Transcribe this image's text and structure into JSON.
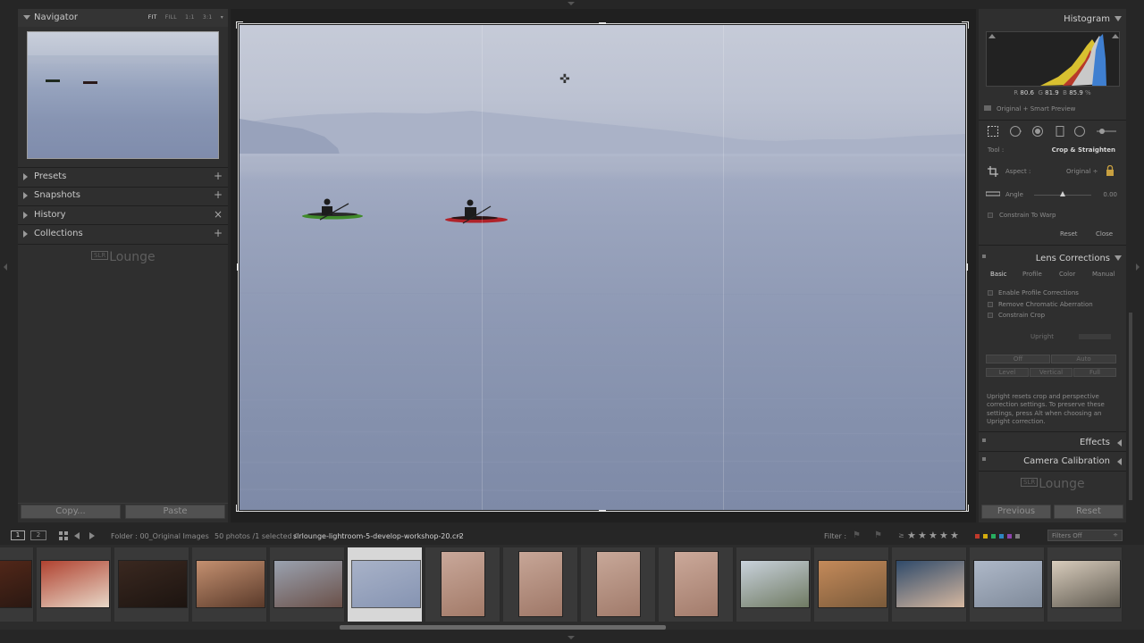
{
  "left_panel": {
    "navigator": {
      "title": "Navigator",
      "zoom_options": [
        "FIT",
        "FILL",
        "1:1",
        "3:1"
      ],
      "zoom_selected": "FIT"
    },
    "sections": [
      {
        "label": "Presets",
        "action": "+"
      },
      {
        "label": "Snapshots",
        "action": "+"
      },
      {
        "label": "History",
        "action": "×"
      },
      {
        "label": "Collections",
        "action": "+"
      }
    ],
    "watermark": {
      "box": "SLR",
      "text": "Lounge"
    },
    "copy_label": "Copy...",
    "paste_label": "Paste"
  },
  "right_panel": {
    "histogram": {
      "title": "Histogram",
      "r_label": "R",
      "r_value": "80.6",
      "g_label": "G",
      "g_value": "81.9",
      "b_label": "B",
      "b_value": "85.9",
      "percent": "%",
      "preview_status": "Original + Smart Preview"
    },
    "crop_tool": {
      "tool_label": "Tool :",
      "tool_name": "Crop & Straighten",
      "aspect_label": "Aspect :",
      "aspect_value": "Original ÷",
      "angle_label": "Angle",
      "angle_value": "0.00",
      "angle_fraction": 0.5,
      "constrain_label": "Constrain To Warp",
      "reset_label": "Reset",
      "close_label": "Close"
    },
    "lens_corrections": {
      "title": "Lens Corrections",
      "tabs": [
        "Basic",
        "Profile",
        "Color",
        "Manual"
      ],
      "active_tab": "Basic",
      "checkboxes": [
        "Enable Profile Corrections",
        "Remove Chromatic Aberration",
        "Constrain Crop"
      ],
      "upright_label": "Upright",
      "upright_buttons_row1": [
        "Off",
        "Auto"
      ],
      "upright_buttons_row2": [
        "Level",
        "Vertical",
        "Full"
      ],
      "upright_note": "Upright resets crop and perspective correction settings. To preserve these settings, press Alt when choosing an Upright correction."
    },
    "effects_title": "Effects",
    "camera_calibration_title": "Camera Calibration",
    "watermark": {
      "box": "SLR",
      "text": "Lounge"
    },
    "previous_label": "Previous",
    "reset_label": "Reset"
  },
  "toolbar": {
    "screen1": "1",
    "screen2": "2",
    "folder_text": "Folder : 00_Original Images",
    "count_text": "50 photos /1 selected /",
    "filename": "slrlounge-lightroom-5-develop-workshop-20.cr2",
    "filename_caret": "÷",
    "filter_label": "Filter :",
    "filters_off": "Filters Off",
    "color_labels": [
      "#c0392b",
      "#d4ac0d",
      "#27ae60",
      "#2e86c1",
      "#8e44ad",
      "#7f7f7f"
    ]
  },
  "filmstrip": {
    "selected_index": 5,
    "thumb_colors": [
      [
        "#5a2a1a",
        "#2a1812"
      ],
      [
        "#b04230",
        "#e8d8c8"
      ],
      [
        "#3a2820",
        "#1c1410"
      ],
      [
        "#c49070",
        "#5a3a2a"
      ],
      [
        "#9aa2b0",
        "#6a5048"
      ],
      [
        "#a8b2c8",
        "#8694b2"
      ],
      [
        "#c9a89a",
        "#a27a68"
      ],
      [
        "#c7a697",
        "#9e7767"
      ],
      [
        "#c8a899",
        "#a07a6a"
      ],
      [
        "#cba99a",
        "#a27b6b"
      ],
      [
        "#c9d2dc",
        "#6f7a62"
      ],
      [
        "#c48a5a",
        "#7a5a3a"
      ],
      [
        "#2f4a6a",
        "#d6b8a0"
      ],
      [
        "#aeb8c8",
        "#7f8a9a"
      ],
      [
        "#d8ccbc",
        "#5f5a50"
      ]
    ]
  }
}
